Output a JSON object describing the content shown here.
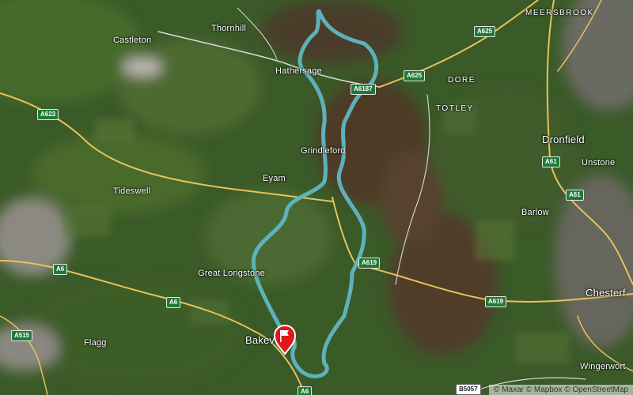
{
  "map": {
    "view": "satellite",
    "route_color": "#5fb7c3",
    "road_color": "#e8c25a",
    "marker": {
      "icon": "flag-marker-icon",
      "color": "#e0181b"
    }
  },
  "places": {
    "castleton": "Castleton",
    "thornhill": "Thornhill",
    "hathersage": "Hathersage",
    "meersbrook": "MEERSBROOK",
    "dore": "DORE",
    "totley": "TOTLEY",
    "grindleford": "Grindleford",
    "eyam": "Eyam",
    "tideswell": "Tideswell",
    "dronfield": "Dronfield",
    "unstone": "Unstone",
    "barlow": "Barlow",
    "great_longstone": "Great Longstone",
    "bakewell": "Bakev",
    "flagg": "Flagg",
    "chesterfield": "Chesterf",
    "wingerworth": "Wingerwort"
  },
  "roads": {
    "a625_n": "A625",
    "a625_s": "A625",
    "a6187": "A6187",
    "a623": "A623",
    "a61_1": "A61",
    "a61_2": "A61",
    "a6_w": "A6",
    "a6_mid": "A6",
    "a6_s": "A6",
    "a619_1": "A619",
    "a619_2": "A619",
    "a515": "A515",
    "b5057": "B5057"
  },
  "attribution": "© Maxar © Mapbox © OpenStreetMap"
}
